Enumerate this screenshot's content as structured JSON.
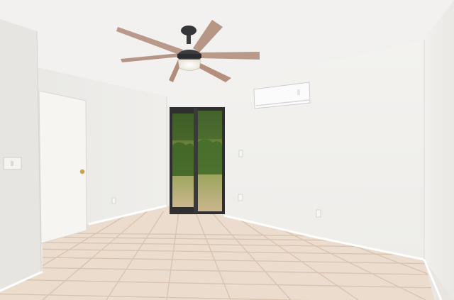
{
  "scene": {
    "watermark": "",
    "colors": {
      "ceiling": "#f2f1ef",
      "left_wall": "#ecebe8",
      "back_wall": "#f4f3f0",
      "right_wall": "#f0efec",
      "floor_tile": "#eddccd",
      "grout": "#d9c5b2",
      "baseboard": "#ffffff",
      "door": "#f7f6f3",
      "door_knob": "#c9a24a",
      "fan_blade": "#b89a86",
      "fan_motor": "#3b3c40",
      "fan_light": "#f5f1e6",
      "ac_unit": "#fbfbfb",
      "glass_outside_top": "#6f8a3f",
      "glass_outside_bottom": "#c9b48a",
      "sliding_frame": "#2f2f30"
    },
    "objects": [
      "ceiling-fan",
      "mini-split-air-conditioner",
      "sliding-glass-door",
      "interior-door",
      "light-switch",
      "electrical-outlet",
      "tile-floor"
    ]
  }
}
